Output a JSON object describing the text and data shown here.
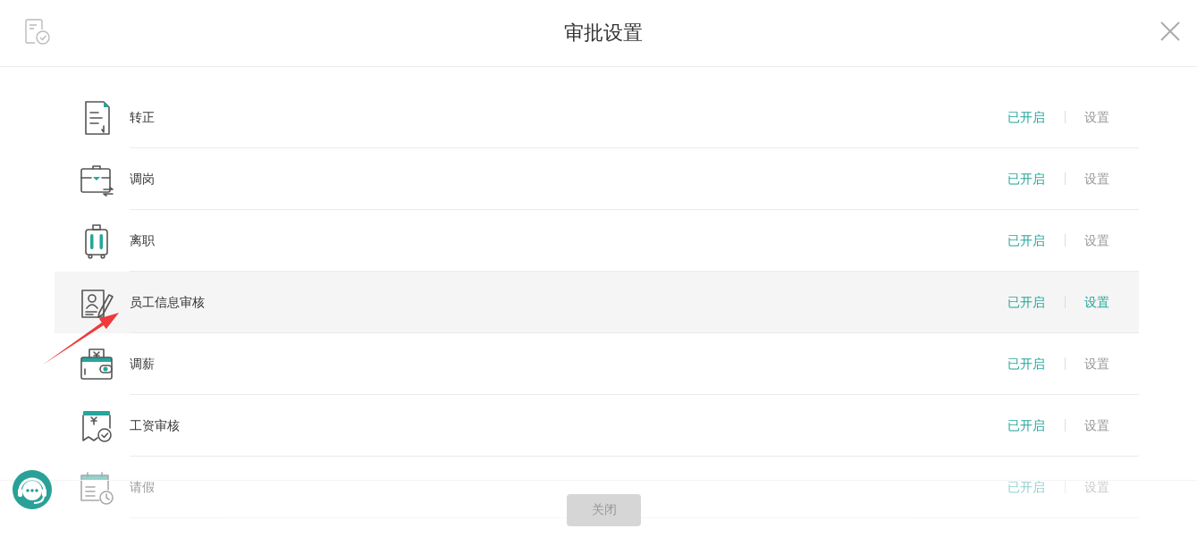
{
  "header": {
    "title": "审批设置"
  },
  "items": [
    {
      "label": "转正",
      "status": "已开启",
      "action": "设置",
      "selected": false
    },
    {
      "label": "调岗",
      "status": "已开启",
      "action": "设置",
      "selected": false
    },
    {
      "label": "离职",
      "status": "已开启",
      "action": "设置",
      "selected": false
    },
    {
      "label": "员工信息审核",
      "status": "已开启",
      "action": "设置",
      "selected": true
    },
    {
      "label": "调薪",
      "status": "已开启",
      "action": "设置",
      "selected": false
    },
    {
      "label": "工资审核",
      "status": "已开启",
      "action": "设置",
      "selected": false
    },
    {
      "label": "请假",
      "status": "已开启",
      "action": "设置",
      "selected": false
    }
  ],
  "footer": {
    "close_button": "关闭"
  }
}
